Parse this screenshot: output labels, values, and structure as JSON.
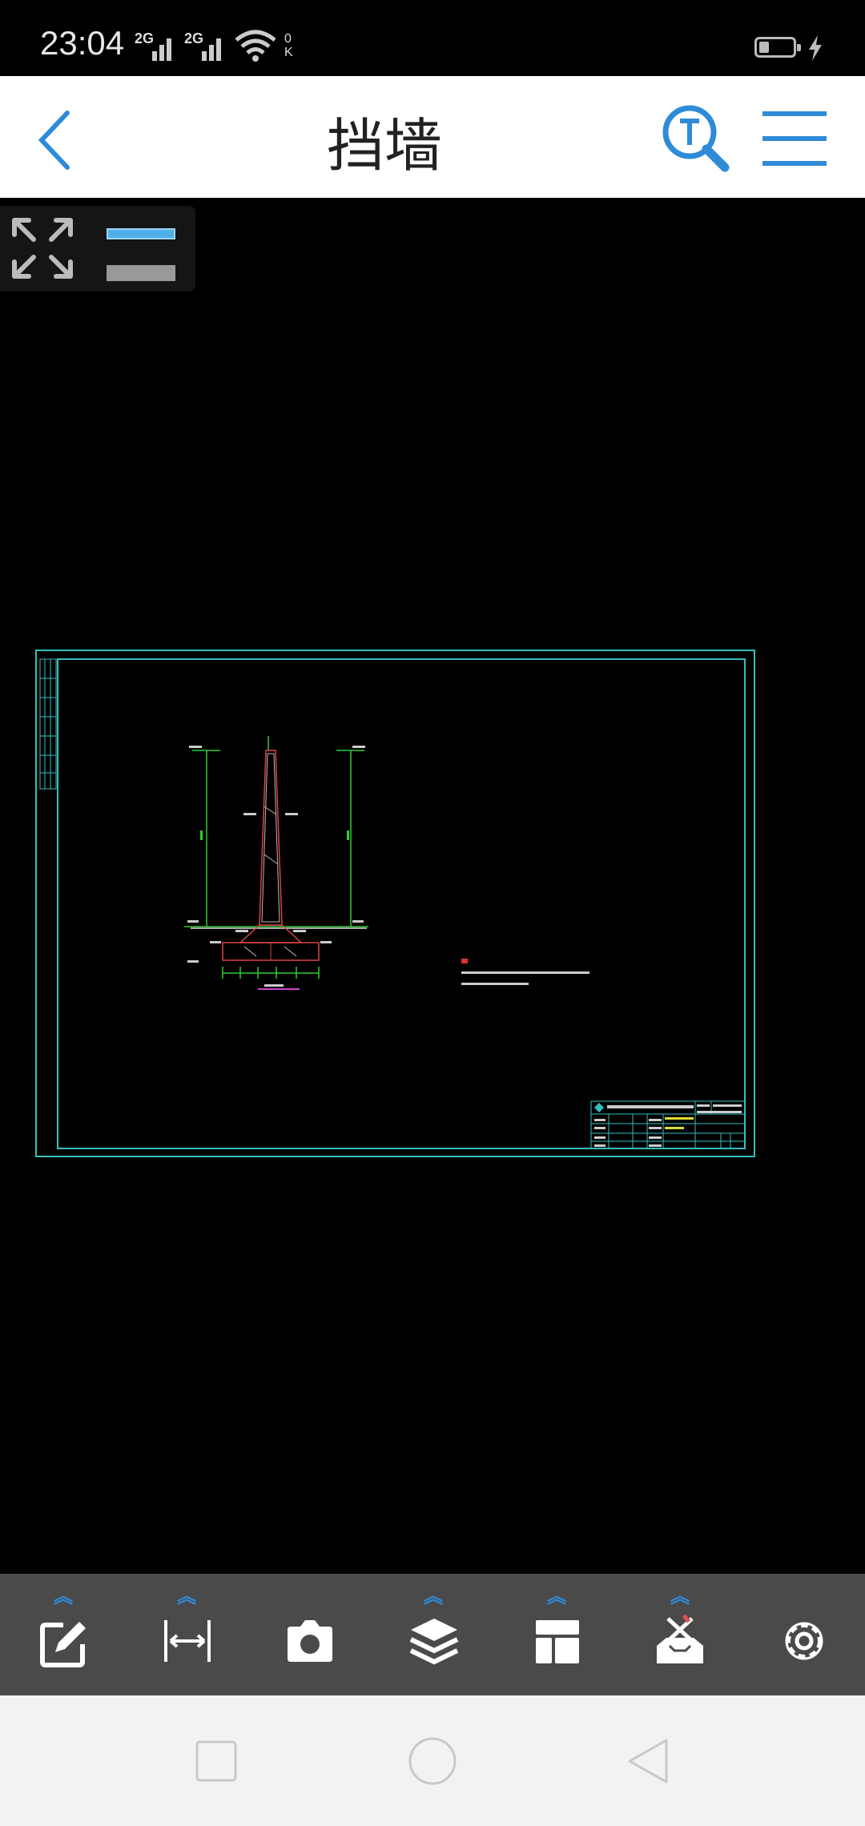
{
  "status_bar": {
    "time": "23:04",
    "sim1_label": "2G",
    "sim2_label": "2G",
    "net_speed_top": "0",
    "net_speed_bottom": "K",
    "icons": [
      "signal-icon",
      "signal-icon",
      "wifi-icon",
      "battery-icon",
      "charging-icon"
    ]
  },
  "app_bar": {
    "title": "挡墙",
    "back_icon": "chevron-left-icon",
    "text_search_icon": "text-search-icon",
    "menu_icon": "hamburger-menu-icon",
    "accent_color": "#2e8bd8"
  },
  "viewer": {
    "background": "#000000",
    "view_controls": [
      "fullscreen-icon",
      "layer-visible",
      "layer-hidden"
    ],
    "drawing_frame_color": "#33c0c0"
  },
  "toolbar": {
    "background": "#4a4a4a",
    "tools": [
      {
        "icon": "edit-icon",
        "has_more": true
      },
      {
        "icon": "measure-icon",
        "has_more": true
      },
      {
        "icon": "camera-icon",
        "has_more": false
      },
      {
        "icon": "layers-icon",
        "has_more": true
      },
      {
        "icon": "layout-icon",
        "has_more": true
      },
      {
        "icon": "tools-icon",
        "has_more": true
      },
      {
        "icon": "settings-icon",
        "has_more": false
      }
    ]
  },
  "nav_bar": {
    "buttons": [
      "recent-apps-icon",
      "home-icon",
      "back-icon"
    ]
  }
}
